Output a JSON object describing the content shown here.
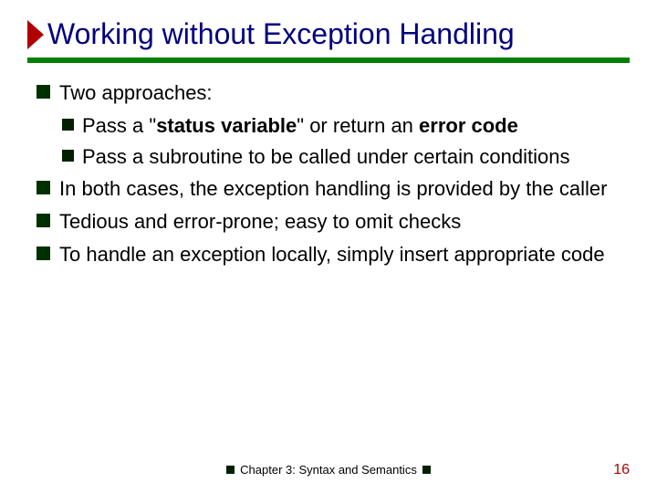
{
  "title": "Working without Exception Handling",
  "bullets": {
    "b0": "Two approaches:",
    "b0a_pre": "Pass a \"",
    "b0a_bold1": "status variable",
    "b0a_mid": "\" or return an ",
    "b0a_bold2": "error code",
    "b0b": "Pass a subroutine to be called under certain conditions",
    "b1": "In both cases, the exception handling is provided by the caller",
    "b2": "Tedious and error-prone; easy to omit checks",
    "b3": "To handle an exception locally, simply insert appropriate code"
  },
  "footer": "Chapter 3: Syntax and Semantics",
  "page": "16"
}
